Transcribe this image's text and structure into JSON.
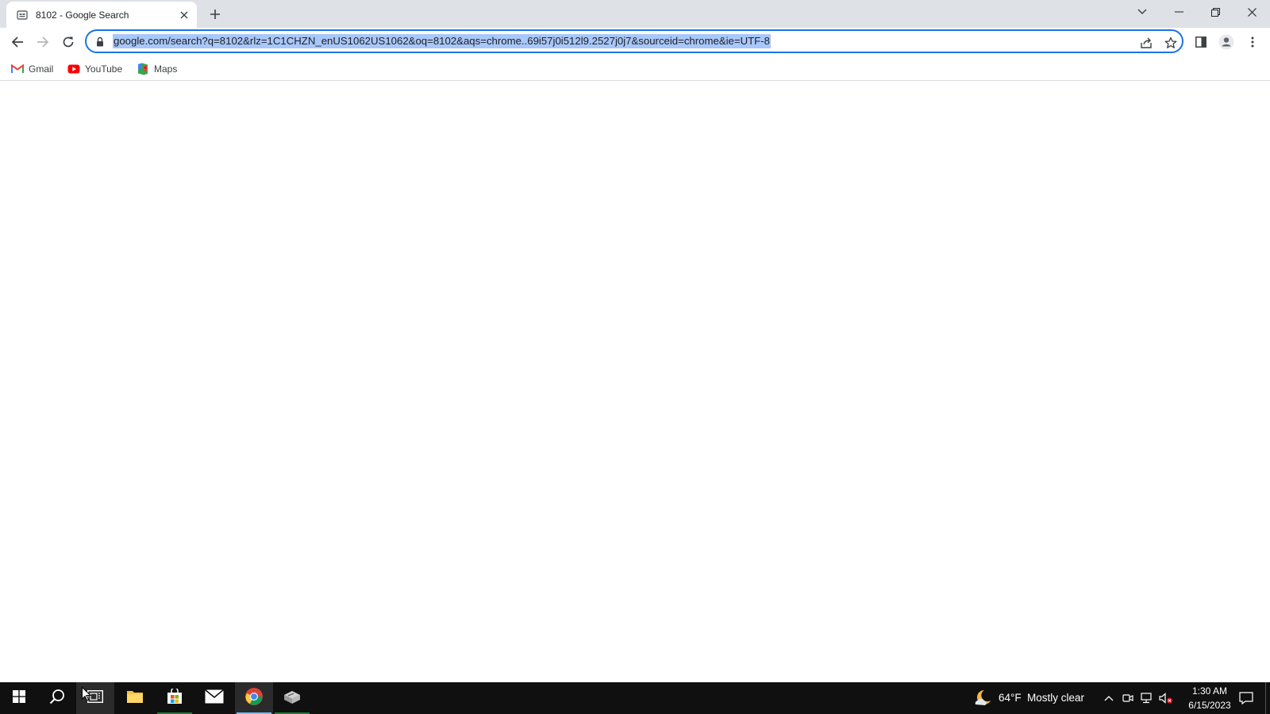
{
  "browser": {
    "tab": {
      "title": "8102 - Google Search",
      "favicon": "google-search-favicon-icon"
    },
    "window_controls": [
      "tab-search-icon",
      "minimize-icon",
      "restore-icon",
      "close-icon"
    ],
    "address_bar": {
      "url": "google.com/search?q=8102&rlz=1C1CHZN_enUS1062US1062&oq=8102&aqs=chrome..69i57j0i512l9.2527j0j7&sourceid=chrome&ie=UTF-8",
      "selected": true
    },
    "bookmarks": [
      {
        "label": "Gmail",
        "icon": "gmail-icon"
      },
      {
        "label": "YouTube",
        "icon": "youtube-icon"
      },
      {
        "label": "Maps",
        "icon": "maps-icon"
      }
    ]
  },
  "taskbar": {
    "pinned": [
      "start-icon",
      "search-icon",
      "task-view-icon",
      "file-explorer-icon",
      "store-icon",
      "mail-icon",
      "chrome-icon",
      "app-icon"
    ],
    "weather": {
      "temperature": "64°F",
      "condition": "Mostly clear"
    },
    "clock": {
      "time": "1:30 AM",
      "date": "6/15/2023"
    }
  },
  "colors": {
    "accent": "#1a73e8",
    "selection": "#a8c7fa",
    "taskbar": "#101010"
  }
}
